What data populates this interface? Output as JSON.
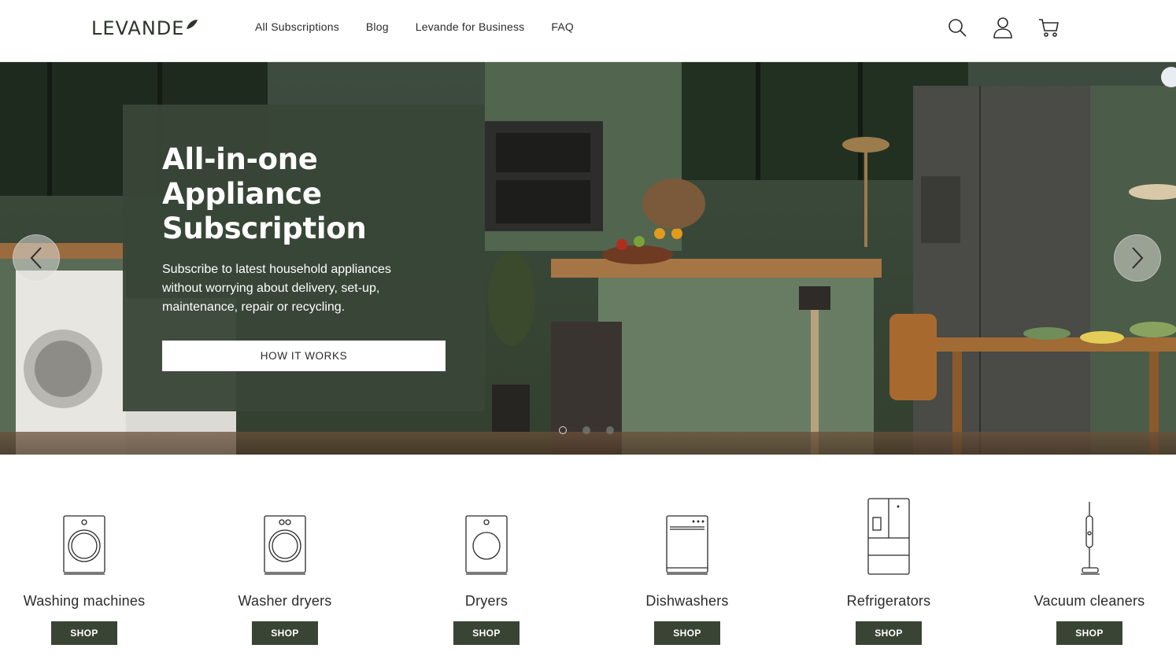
{
  "brand": {
    "logo_text": "LEVANDE"
  },
  "nav": {
    "items": [
      {
        "label": "All Subscriptions"
      },
      {
        "label": "Blog"
      },
      {
        "label": "Levande for Business"
      },
      {
        "label": "FAQ"
      }
    ]
  },
  "header_icons": [
    "search-icon",
    "account-icon",
    "cart-icon"
  ],
  "hero": {
    "title": "All-in-one Appliance Subscription",
    "description": "Subscribe to latest household appliances without worrying about delivery, set-up, maintenance, repair or recycling.",
    "cta_label": "HOW IT WORKS",
    "slides_count": 3,
    "active_slide": 1
  },
  "categories": [
    {
      "label": "Washing machines",
      "button": "SHOP",
      "icon": "washing-machine-icon"
    },
    {
      "label": "Washer dryers",
      "button": "SHOP",
      "icon": "washer-dryer-icon"
    },
    {
      "label": "Dryers",
      "button": "SHOP",
      "icon": "dryer-icon"
    },
    {
      "label": "Dishwashers",
      "button": "SHOP",
      "icon": "dishwasher-icon"
    },
    {
      "label": "Refrigerators",
      "button": "SHOP",
      "icon": "refrigerator-icon"
    },
    {
      "label": "Vacuum cleaners",
      "button": "SHOP",
      "icon": "vacuum-cleaner-icon"
    }
  ],
  "colors": {
    "brand_dark_green": "#3a4435",
    "panel_green": "#384637",
    "text_dark": "#2b2b2b"
  }
}
